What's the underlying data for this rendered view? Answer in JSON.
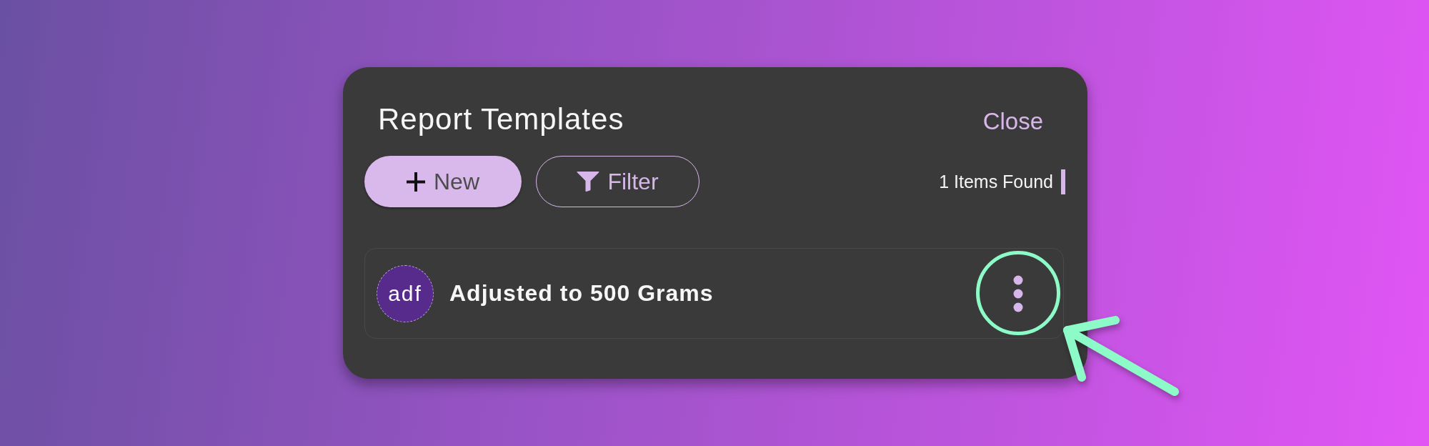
{
  "dialog": {
    "title": "Report Templates",
    "close_label": "Close"
  },
  "toolbar": {
    "buttons": [
      {
        "kind": "primary",
        "label": "New"
      },
      {
        "kind": "outline",
        "label": "Filter"
      }
    ],
    "result_count": "1 Items Found"
  },
  "templates": [
    {
      "name": "Adjusted to 500 Grams",
      "logo_text": "adf",
      "menu_highlighted": true
    }
  ]
}
